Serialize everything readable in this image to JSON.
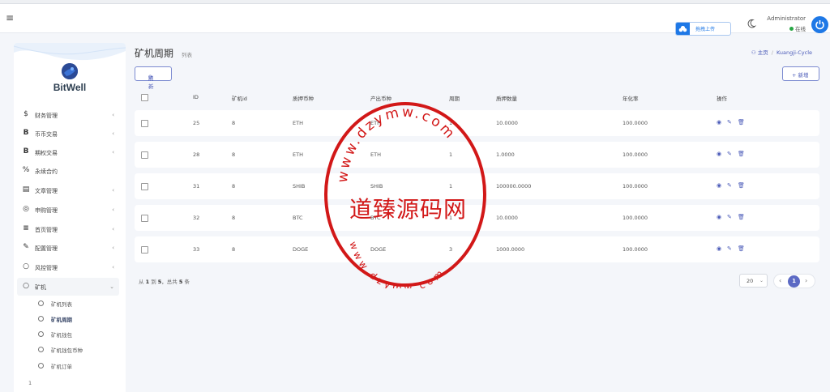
{
  "navbar": {
    "upload_label": "拖拽上传",
    "admin_name": "Administrator",
    "admin_status": "在线"
  },
  "sidebar": {
    "brand": "BitWell",
    "menu": [
      {
        "icon": "dollar-icon",
        "glyph": "$",
        "label": "财务管理"
      },
      {
        "icon": "bitcoin-icon",
        "glyph": "B",
        "label": "币币交易"
      },
      {
        "icon": "bitcoin-icon",
        "glyph": "B",
        "label": "期权交易"
      },
      {
        "icon": "percent-icon",
        "glyph": "%",
        "label": "永续合约"
      },
      {
        "icon": "newspaper-icon",
        "glyph": "▤",
        "label": "文章管理"
      },
      {
        "icon": "lifebuoy-icon",
        "glyph": "◎",
        "label": "申购管理"
      },
      {
        "icon": "list-icon",
        "glyph": "≡",
        "label": "首页管理"
      },
      {
        "icon": "wrench-icon",
        "glyph": "✎",
        "label": "配置管理"
      },
      {
        "icon": "circle-icon",
        "glyph": "○",
        "label": "风控管理"
      },
      {
        "icon": "circle-icon",
        "glyph": "○",
        "label": "矿机"
      }
    ],
    "submenu": [
      {
        "label": "矿机列表",
        "active": false
      },
      {
        "label": "矿机周期",
        "active": true
      },
      {
        "label": "矿机钱包",
        "active": false
      },
      {
        "label": "矿机钱包币种",
        "active": false
      },
      {
        "label": "矿机订单",
        "active": false
      }
    ],
    "footer": "1"
  },
  "page": {
    "title": "矿机周期",
    "subtitle": "列表",
    "breadcrumb_home": "主页",
    "breadcrumb_current": "Kuangji-Cycle"
  },
  "toolbar": {
    "refresh_label": "刷新",
    "add_label": "+ 新增"
  },
  "table": {
    "columns": [
      "ID",
      "矿机id",
      "质押币种",
      "产出币种",
      "周期",
      "质押数量",
      "年化率",
      "操作"
    ],
    "rows": [
      {
        "id": "25",
        "mid": "8",
        "coin": "ETH",
        "out": "ETH",
        "cycle": "1",
        "qty": "10.0000",
        "rate": "100.0000"
      },
      {
        "id": "28",
        "mid": "8",
        "coin": "ETH",
        "out": "ETH",
        "cycle": "1",
        "qty": "1.0000",
        "rate": "100.0000"
      },
      {
        "id": "31",
        "mid": "8",
        "coin": "SHIB",
        "out": "SHIB",
        "cycle": "1",
        "qty": "100000.0000",
        "rate": "100.0000"
      },
      {
        "id": "32",
        "mid": "8",
        "coin": "BTC",
        "out": "BTC",
        "cycle": "1",
        "qty": "10.0000",
        "rate": "100.0000"
      },
      {
        "id": "33",
        "mid": "8",
        "coin": "DOGE",
        "out": "DOGE",
        "cycle": "3",
        "qty": "1000.0000",
        "rate": "100.0000"
      }
    ]
  },
  "pagination": {
    "summary_prefix": "从",
    "from": "1",
    "summary_to": "到",
    "to": "5",
    "summary_total": "，总共",
    "total": "5",
    "summary_suffix": "条",
    "per_page": "20",
    "current_page": "1"
  },
  "watermark": {
    "main": "道臻源码网",
    "ring_top": "www.dzymw.com",
    "ring_bottom": "www.dzymw.com",
    "color": "#d21818"
  }
}
